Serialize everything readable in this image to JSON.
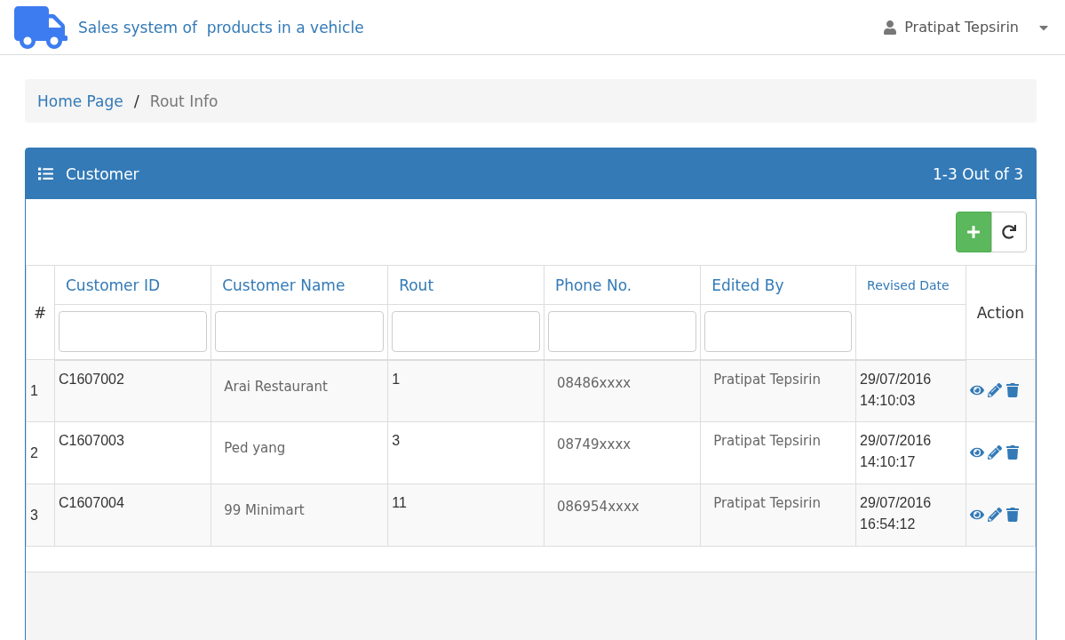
{
  "app_title": "Sales system of  products in a vehicle",
  "user": {
    "name": "Pratipat Tepsirin"
  },
  "breadcrumb_separator": "/",
  "breadcrumb": [
    {
      "label": "Home Page",
      "kind": "link"
    },
    {
      "label": "Rout Info",
      "kind": "current"
    }
  ],
  "panel": {
    "title": "Customer",
    "count": "1-3 Out of 3"
  },
  "table": {
    "index_header": "#",
    "action_header": "Action",
    "columns": [
      {
        "label": "Customer ID",
        "filter": true
      },
      {
        "label": "Customer Name",
        "filter": true
      },
      {
        "label": "Rout",
        "filter": true
      },
      {
        "label": "Phone No.",
        "filter": true
      },
      {
        "label": "Edited By",
        "filter": true
      },
      {
        "label": "Revised Date",
        "filter": false
      }
    ],
    "rows": [
      {
        "index": "1",
        "id": "C1607002",
        "name": "Arai Restaurant",
        "rout": "1",
        "phone": "08486xxxx",
        "edited_by": "Pratipat Tepsirin",
        "date": "29/07/2016",
        "time": "14:10:03"
      },
      {
        "index": "2",
        "id": "C1607003",
        "name": "Ped yang",
        "rout": "3",
        "phone": "08749xxxx",
        "edited_by": "Pratipat Tepsirin",
        "date": "29/07/2016",
        "time": "14:10:17"
      },
      {
        "index": "3",
        "id": "C1607004",
        "name": "99 Minimart",
        "rout": "11",
        "phone": "086954xxxx",
        "edited_by": "Pratipat Tepsirin",
        "date": "29/07/2016",
        "time": "16:54:12"
      }
    ]
  }
}
